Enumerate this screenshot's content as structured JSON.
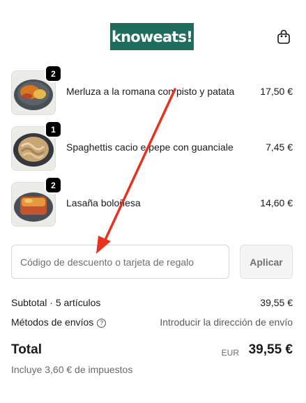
{
  "header": {
    "logo_text": "knoweats!",
    "brand_color": "#1f6b5c",
    "cart_icon": "shopping-bag-icon"
  },
  "cart": {
    "items": [
      {
        "quantity": "2",
        "name": "Merluza a la romana con pisto y patata",
        "price": "17,50 €"
      },
      {
        "quantity": "1",
        "name": "Spaghettis cacio e pepe con guanciale",
        "price": "7,45 €"
      },
      {
        "quantity": "2",
        "name": "Lasaña boloñesa",
        "price": "14,60 €"
      }
    ]
  },
  "discount": {
    "placeholder": "Código de descuento o tarjeta de regalo",
    "value": "",
    "apply_label": "Aplicar"
  },
  "summary": {
    "subtotal_label": "Subtotal · 5 artículos",
    "subtotal_value": "39,55 €",
    "shipping_label": "Métodos de envíos",
    "shipping_help_icon": "question-circle-icon",
    "shipping_value": "Introducir la dirección de envío",
    "total_label": "Total",
    "total_currency": "EUR",
    "total_value": "39,55 €",
    "taxes_note": "Incluye 3,60 € de impuestos"
  },
  "annotation": {
    "arrow_color": "#e8321e",
    "arrow_icon": "red-arrow-annotation"
  }
}
